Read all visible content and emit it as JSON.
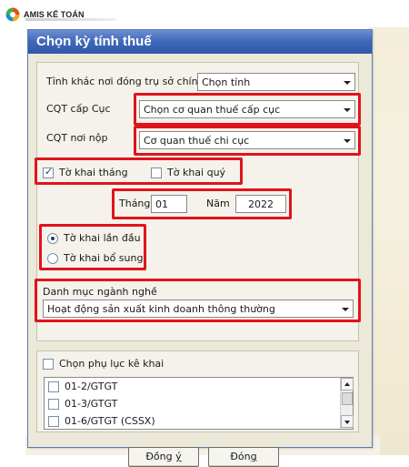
{
  "app": {
    "logo_text": "AMIS KẾ TOÁN"
  },
  "colors": {
    "highlight": "#e0141b",
    "titlebar": "#3d67b8"
  },
  "dialog": {
    "title": "Chọn kỳ tính thuế",
    "province_label": "Tỉnh khác nơi đóng trụ sở chính",
    "province_value": "Chọn tỉnh",
    "cqt_cuc_label": "CQT cấp Cục",
    "cqt_cuc_value": "Chọn cơ quan thuế cấp cục",
    "cqt_noi_nop_label": "CQT nơi nộp",
    "cqt_noi_nop_value": "Cơ quan thuế chi cục",
    "to_khai_thang_label": "Tờ khai tháng",
    "to_khai_thang_checked": true,
    "to_khai_quy_label": "Tờ khai quý",
    "to_khai_quy_checked": false,
    "thang_label": "Tháng",
    "thang_value": "01",
    "nam_label": "Năm",
    "nam_value": "2022",
    "lan_dau_label": "Tờ khai lần đầu",
    "lan_dau_selected": true,
    "bo_sung_label": "Tờ khai bổ sung",
    "bo_sung_selected": false,
    "nganh_nghe_label": "Danh mục ngành nghề",
    "nganh_nghe_value": "Hoạt động sản xuất kinh doanh thông thường",
    "phu_luc_label": "Chọn phụ lục kê khai",
    "phu_luc_items": [
      "01-2/GTGT",
      "01-3/GTGT",
      "01-6/GTGT (CSSX)"
    ],
    "ok_label_pre": "Đồng ",
    "ok_label_key": "ý",
    "close_label_pre": "Đón",
    "close_label_key": "g"
  }
}
